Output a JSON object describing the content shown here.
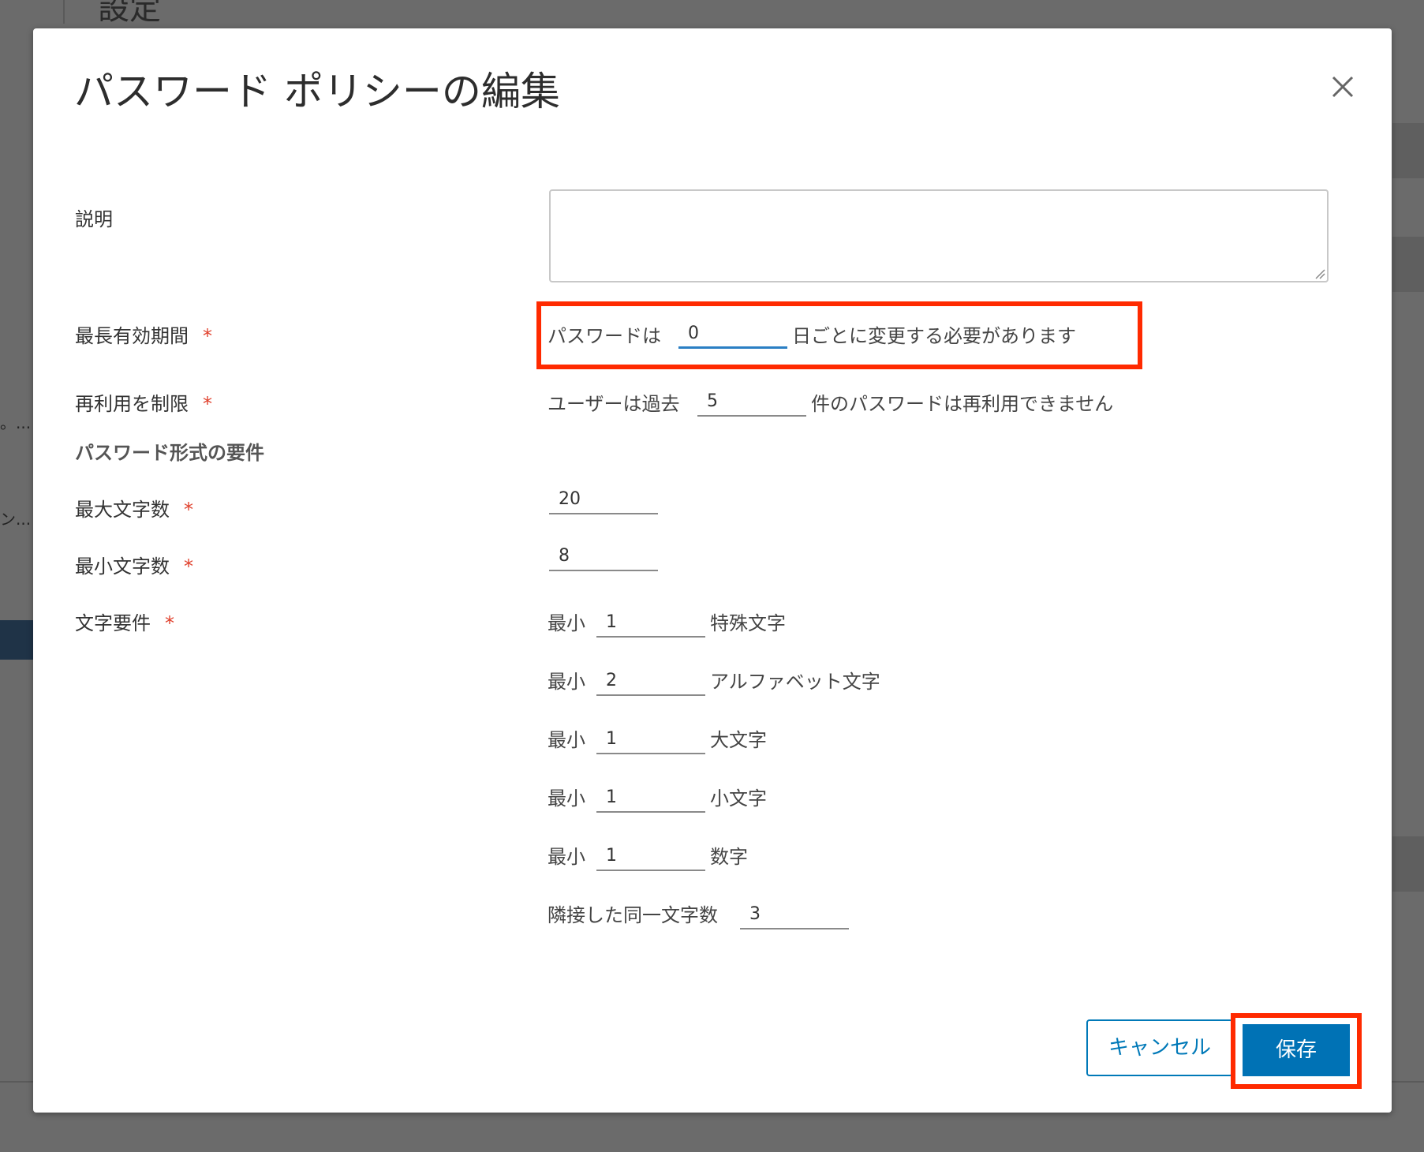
{
  "background": {
    "page_title": "設定",
    "truncated_1": "。...",
    "truncated_2": "ン..."
  },
  "dialog": {
    "title": "パスワード ポリシーの編集",
    "close_icon": "close-icon"
  },
  "form": {
    "description": {
      "label": "説明",
      "value": ""
    },
    "max_lifetime": {
      "label": "最長有効期間",
      "required_mark": "*",
      "prefix": "パスワードは",
      "value": "0",
      "suffix": "日ごとに変更する必要があります"
    },
    "reuse": {
      "label": "再利用を制限",
      "required_mark": "*",
      "prefix": "ユーザーは過去",
      "value": "5",
      "suffix": "件のパスワードは再利用できません"
    },
    "format_section": "パスワード形式の要件",
    "max_length": {
      "label": "最大文字数",
      "required_mark": "*",
      "value": "20"
    },
    "min_length": {
      "label": "最小文字数",
      "required_mark": "*",
      "value": "8"
    },
    "char_requirements": {
      "label": "文字要件",
      "required_mark": "*",
      "rows": [
        {
          "prefix": "最小",
          "value": "1",
          "suffix": "特殊文字"
        },
        {
          "prefix": "最小",
          "value": "2",
          "suffix": "アルファベット文字"
        },
        {
          "prefix": "最小",
          "value": "1",
          "suffix": "大文字"
        },
        {
          "prefix": "最小",
          "value": "1",
          "suffix": "小文字"
        },
        {
          "prefix": "最小",
          "value": "1",
          "suffix": "数字"
        }
      ],
      "adjacent": {
        "prefix": "隣接した同一文字数",
        "value": "3"
      }
    }
  },
  "buttons": {
    "cancel": "キャンセル",
    "save": "保存"
  },
  "colors": {
    "primary": "#0072b5",
    "highlight": "#ff2a00",
    "required": "#e0402c",
    "focus": "#2a7fc4"
  }
}
